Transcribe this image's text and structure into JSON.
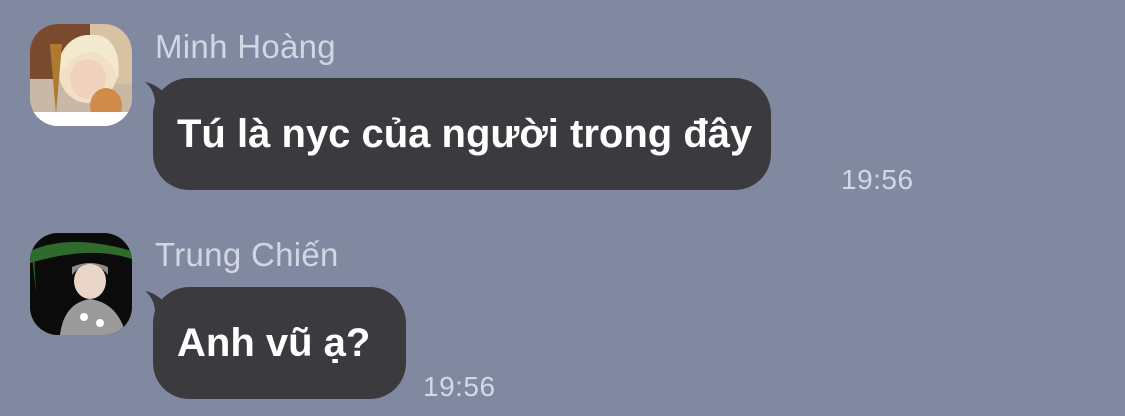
{
  "messages": [
    {
      "sender": "Minh Hoàng",
      "text": "Tú là nyc của người trong đây",
      "time": "19:56",
      "avatar_icon": "user-avatar-photo"
    },
    {
      "sender": "Trung Chiến",
      "text": "Anh vũ ạ?",
      "time": "19:56",
      "avatar_icon": "user-avatar-photo"
    }
  ],
  "colors": {
    "background": "#8089a0",
    "bubble": "#3b3b3f",
    "bubble_text": "#ffffff",
    "meta_text": "#d1d6e3"
  }
}
